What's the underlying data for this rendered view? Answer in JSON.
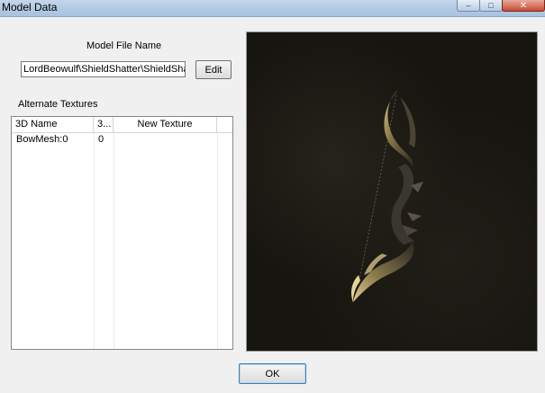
{
  "window": {
    "title": "Model Data",
    "close_glyph": "✕",
    "minimize_glyph": "–",
    "maximize_glyph": "□"
  },
  "model_file": {
    "label": "Model File Name",
    "value": "LordBeowulf\\ShieldShatter\\ShieldSha",
    "edit_label": "Edit"
  },
  "textures": {
    "label": "Alternate Textures",
    "columns": [
      "3D Name",
      "3...",
      "New Texture"
    ],
    "rows": [
      {
        "name": "BowMesh:0",
        "index": "0",
        "texture": ""
      }
    ]
  },
  "preview": {
    "subject": "bow-mesh-render",
    "background_color": "#17150f"
  },
  "footer": {
    "ok_label": "OK"
  }
}
